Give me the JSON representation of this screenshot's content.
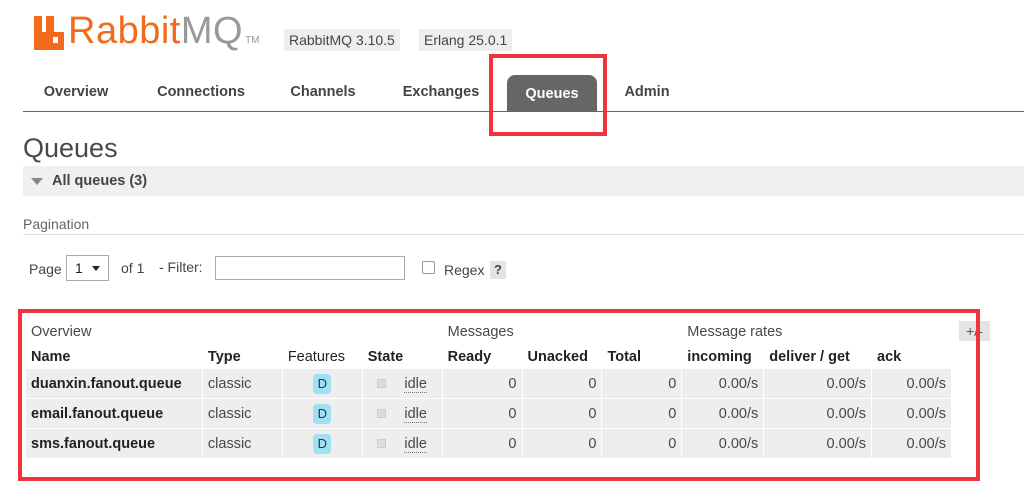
{
  "header": {
    "logo_rabbit": "Rabbit",
    "logo_mq": "MQ",
    "logo_tm": "TM",
    "rabbitmq_version": "RabbitMQ 3.10.5",
    "erlang_version": "Erlang 25.0.1"
  },
  "tabs": [
    {
      "label": "Overview"
    },
    {
      "label": "Connections"
    },
    {
      "label": "Channels"
    },
    {
      "label": "Exchanges"
    },
    {
      "label": "Queues"
    },
    {
      "label": "Admin"
    }
  ],
  "active_tab": "Queues",
  "page_title": "Queues",
  "section": {
    "label": "All queues (3)"
  },
  "pagination": {
    "label": "Pagination",
    "page_label": "Page",
    "page_value": "1",
    "of_label": "of 1",
    "filter_label": "- Filter:",
    "filter_value": "",
    "regex_label": "Regex",
    "help_label": "?"
  },
  "table": {
    "groups": [
      "Overview",
      "Messages",
      "Message rates"
    ],
    "columns": [
      "Name",
      "Type",
      "Features",
      "State",
      "Ready",
      "Unacked",
      "Total",
      "incoming",
      "deliver / get",
      "ack"
    ],
    "rows": [
      {
        "name": "duanxin.fanout.queue",
        "type": "classic",
        "feature": "D",
        "state": "idle",
        "ready": "0",
        "unacked": "0",
        "total": "0",
        "incoming": "0.00/s",
        "deliver": "0.00/s",
        "ack": "0.00/s"
      },
      {
        "name": "email.fanout.queue",
        "type": "classic",
        "feature": "D",
        "state": "idle",
        "ready": "0",
        "unacked": "0",
        "total": "0",
        "incoming": "0.00/s",
        "deliver": "0.00/s",
        "ack": "0.00/s"
      },
      {
        "name": "sms.fanout.queue",
        "type": "classic",
        "feature": "D",
        "state": "idle",
        "ready": "0",
        "unacked": "0",
        "total": "0",
        "incoming": "0.00/s",
        "deliver": "0.00/s",
        "ack": "0.00/s"
      }
    ],
    "plus_minus": "+/-"
  },
  "colors": {
    "brand_orange": "#f26b1d",
    "highlight_red": "#f1333d",
    "active_tab": "#666666",
    "feature_badge": "#9fe0f5"
  }
}
